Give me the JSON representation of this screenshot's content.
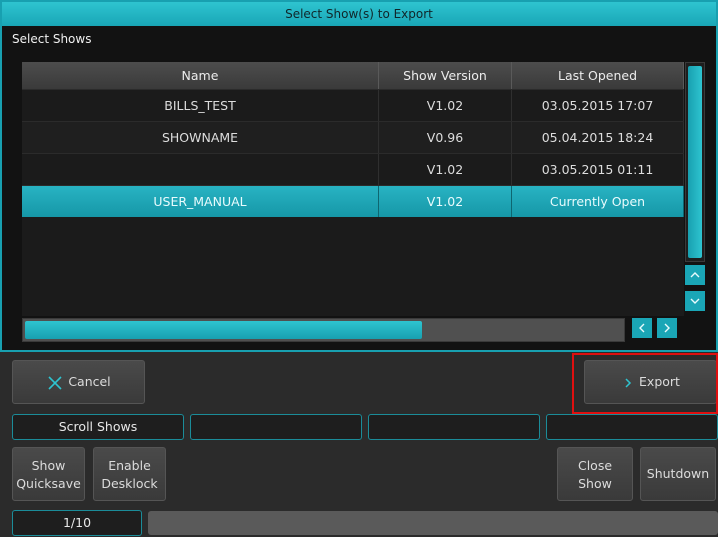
{
  "dialog": {
    "title": "Select Show(s) to Export",
    "section_label": "Select Shows",
    "columns": [
      "Name",
      "Show Version",
      "Last Opened"
    ],
    "rows": [
      {
        "name": "BILLS_TEST",
        "version": "V1.02",
        "last_opened": "03.05.2015 17:07",
        "selected": false
      },
      {
        "name": "SHOWNAME",
        "version": "V0.96",
        "last_opened": "05.04.2015 18:24",
        "selected": false
      },
      {
        "name": "",
        "version": "V1.02",
        "last_opened": "03.05.2015 01:11",
        "selected": false
      },
      {
        "name": "USER_MANUAL",
        "version": "V1.02",
        "last_opened": "Currently Open",
        "selected": true
      }
    ],
    "scroll_up_icon": "chevron-up-icon",
    "scroll_down_icon": "chevron-down-icon",
    "scroll_left_icon": "chevron-left-icon",
    "scroll_right_icon": "chevron-right-icon"
  },
  "actions": {
    "cancel_label": "Cancel",
    "cancel_icon": "close-icon",
    "export_label": "Export",
    "export_icon": "chevron-right-icon"
  },
  "slots": {
    "slot1": "Scroll Shows",
    "slot2": "",
    "slot3": "",
    "slot4": ""
  },
  "bottom": {
    "show_quicksave": [
      "Show",
      "Quicksave"
    ],
    "enable_desklock": [
      "Enable",
      "Desklock"
    ],
    "close_show": [
      "Close",
      "Show"
    ],
    "shutdown": "Shutdown",
    "page_indicator": "1/10"
  },
  "colors": {
    "accent": "#1aa6b6",
    "highlight": "#e01010"
  }
}
